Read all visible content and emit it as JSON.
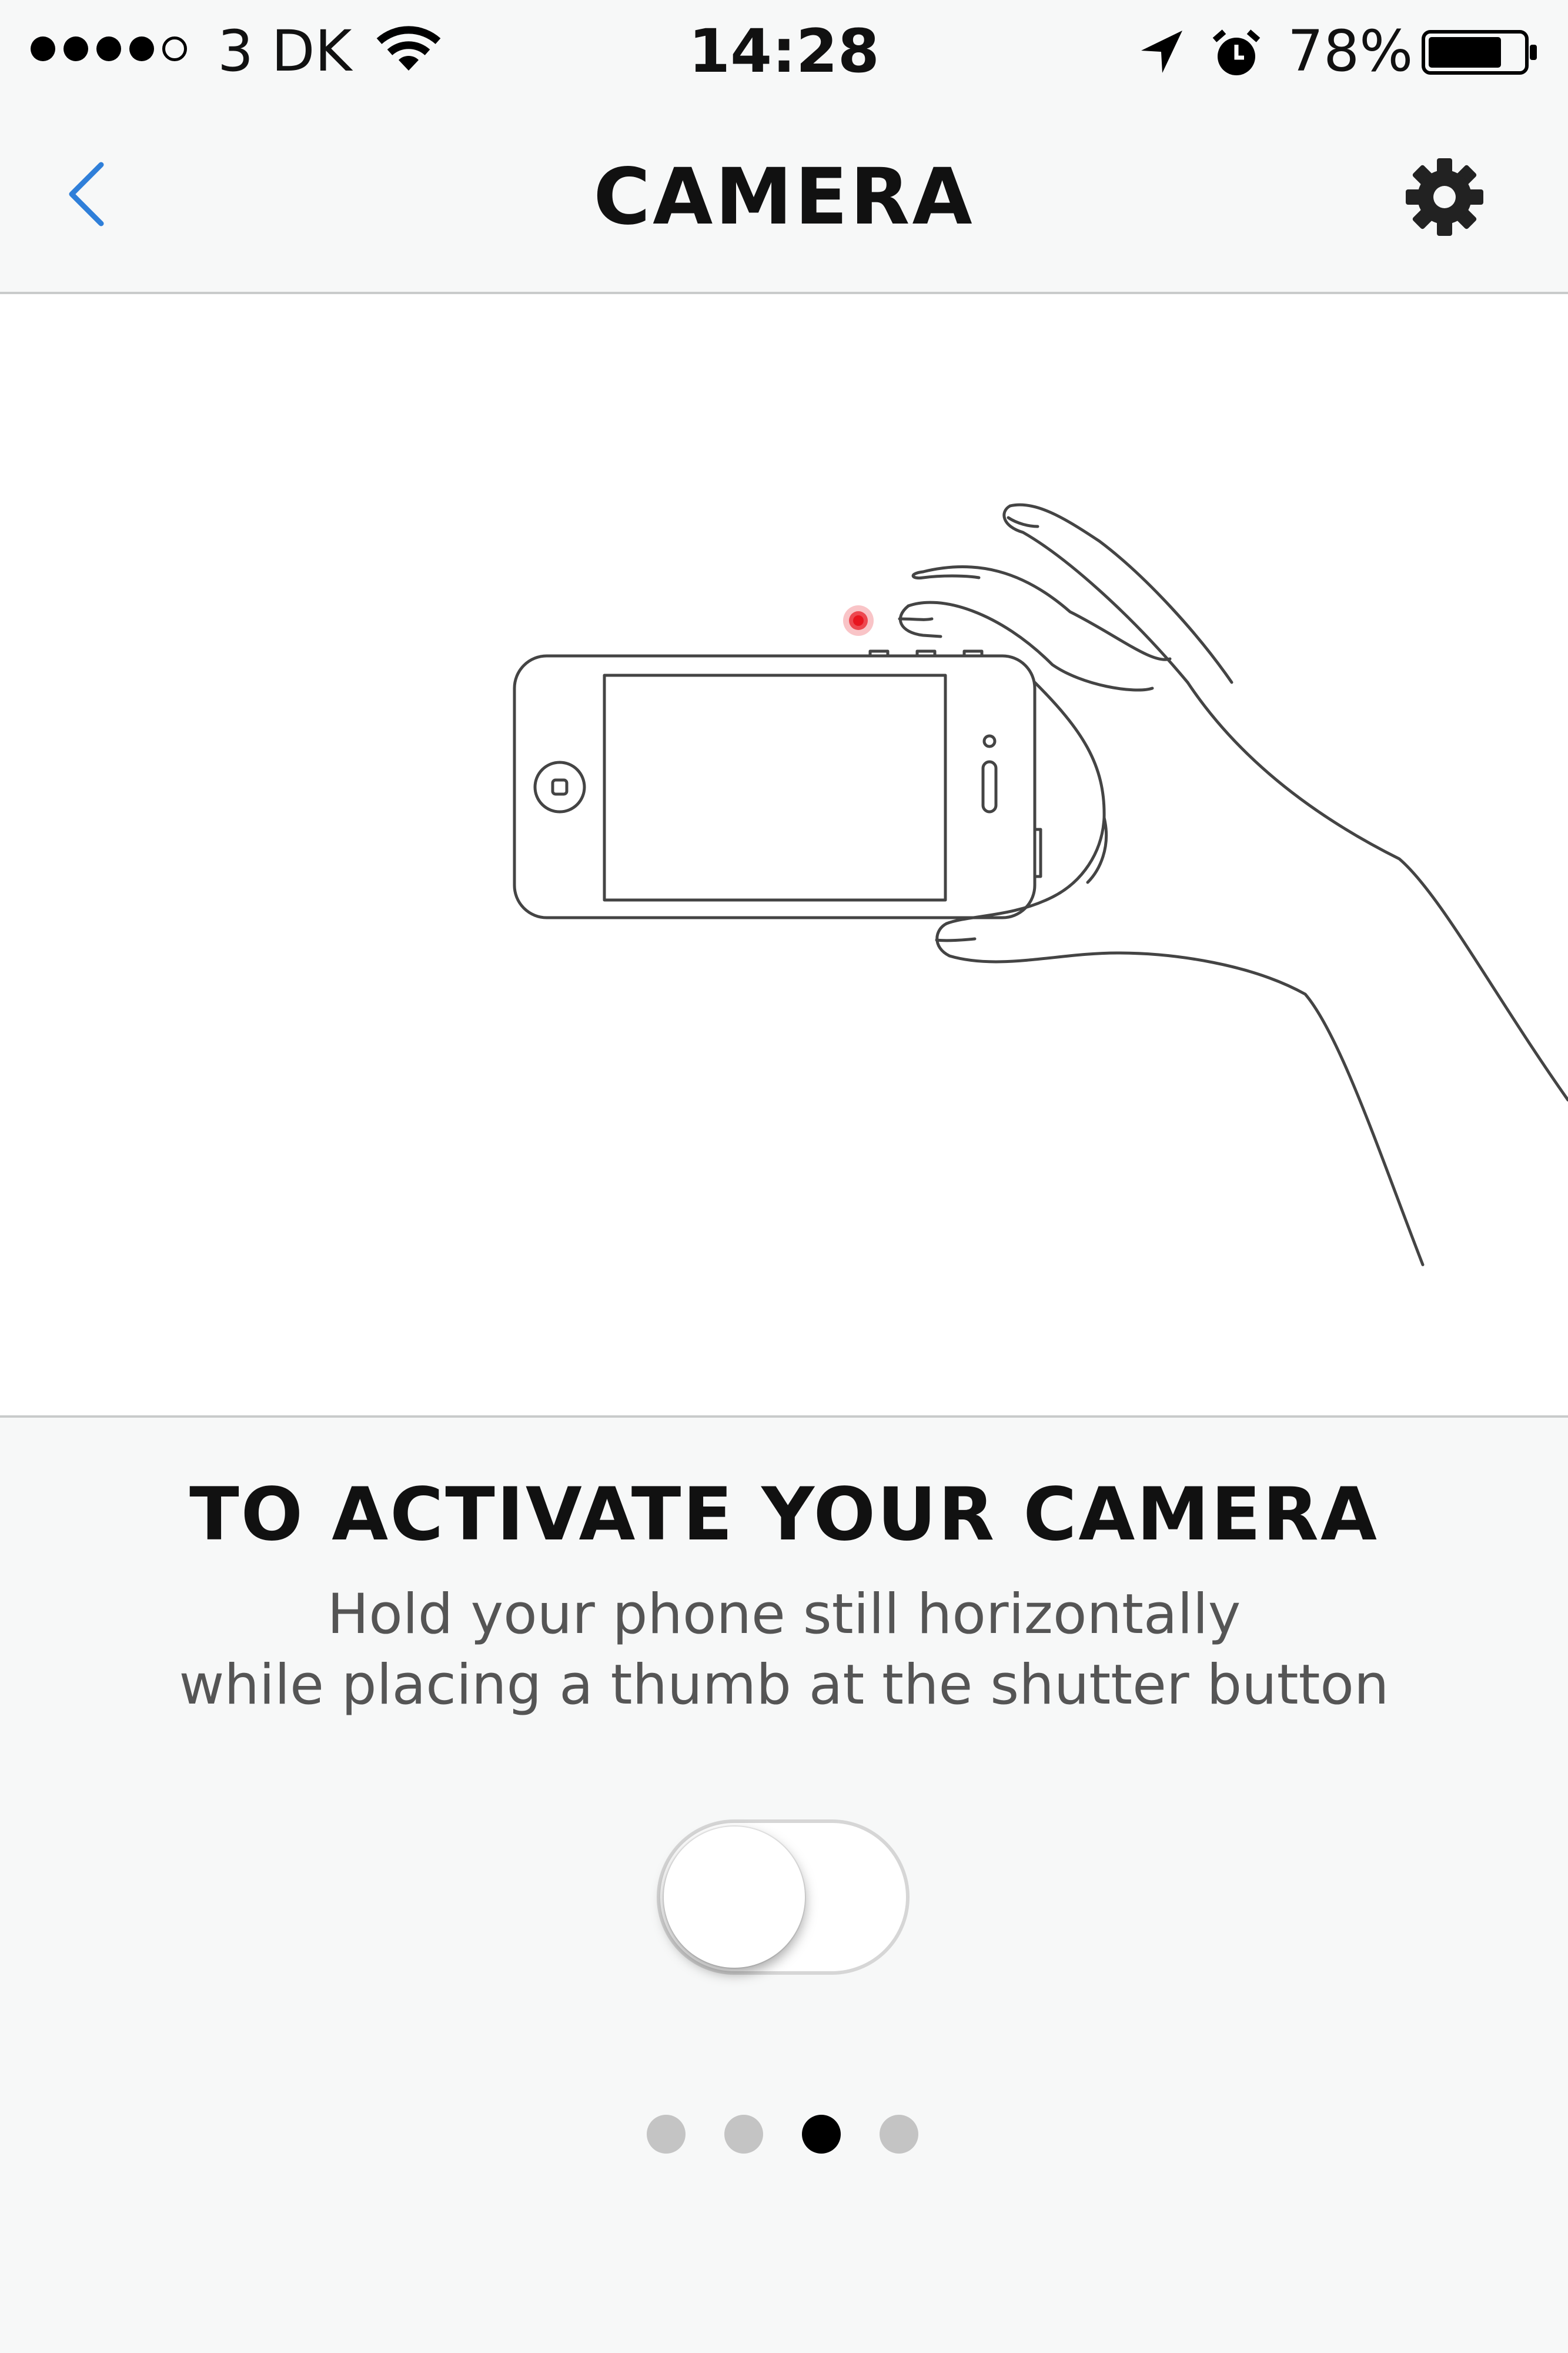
{
  "status_bar": {
    "carrier": "3 DK",
    "time": "14:28",
    "battery": "78%",
    "signal_bars": 4,
    "signal_max": 5,
    "battery_level": 0.78
  },
  "nav": {
    "title": "CAMERA",
    "back_icon": "chevron-left-icon",
    "settings_icon": "gear-icon",
    "accent_color": "#2f7fd9"
  },
  "illustration": {
    "description_icon": "hand-holding-phone-illustration",
    "shutter_indicator_color": "#e8141e"
  },
  "info": {
    "heading": "TO ACTIVATE YOUR CAMERA",
    "body_line1": "Hold your phone still horizontally",
    "body_line2": "while placing a thumb at the shutter button"
  },
  "toggle": {
    "on": false
  },
  "pager": {
    "total": 4,
    "active_index": 2
  }
}
